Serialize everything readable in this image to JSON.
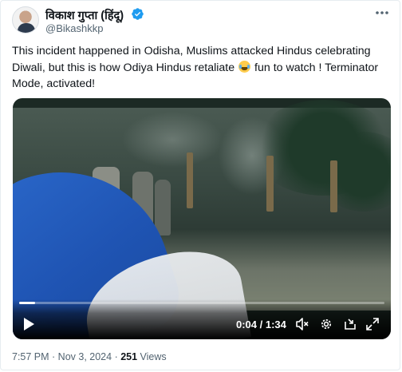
{
  "author": {
    "display_name": "विकाश गुप्ता (हिंदू)",
    "handle": "@Bikashkkp",
    "verified_badge_color": "#1d9bf0"
  },
  "tweet": {
    "text_before_emoji": "This incident happened in Odisha, Muslims attacked Hindus celebrating Diwali, but this is how Odiya Hindus retaliate ",
    "emoji": "face-with-tears-of-joy",
    "text_after_emoji": " fun to watch ! Terminator Mode, activated!"
  },
  "video": {
    "current_time": "0:04",
    "separator": " / ",
    "duration": "1:34",
    "progress": 0.043,
    "icons": [
      "play-icon",
      "volume-muted-icon",
      "settings-icon",
      "popout-icon",
      "fullscreen-icon"
    ]
  },
  "meta": {
    "time": "7:57 PM",
    "dot": " · ",
    "date": "Nov 3, 2024",
    "views_count": "251",
    "views_label": " Views"
  },
  "colors": {
    "text_primary": "#0f1419",
    "text_secondary": "#536471",
    "accent": "#1d9bf0"
  }
}
